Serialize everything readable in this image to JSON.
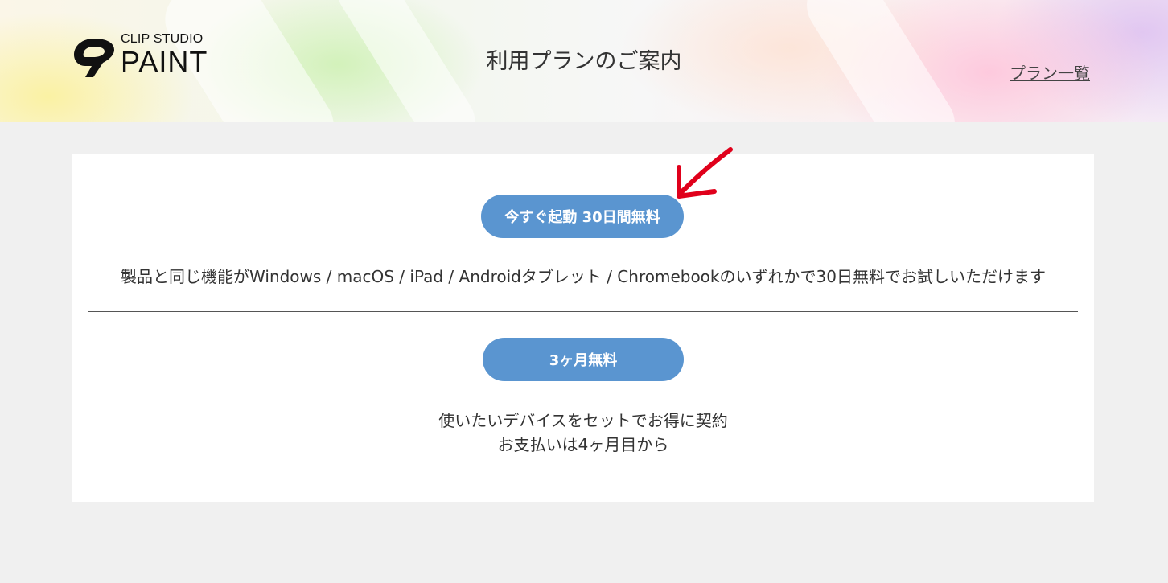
{
  "header": {
    "logo": {
      "small_text": "CLIP STUDIO",
      "big_text": "PAINT"
    },
    "title": "利用プランのご案内",
    "plan_list_link": "プラン一覧"
  },
  "main": {
    "trial": {
      "button_label": "今すぐ起動 30日間無料",
      "description": "製品と同じ機能がWindows / macOS / iPad / Androidタブレット / Chromebookのいずれかで30日無料でお試しいただけます"
    },
    "three_month": {
      "button_label": "3ヶ月無料",
      "description_line1": "使いたいデバイスをセットでお得に契約",
      "description_line2": "お支払いは4ヶ月目から"
    }
  },
  "colors": {
    "button": "#5a95d0",
    "annotation_arrow": "#e0001b",
    "page_background": "#f0f0f0"
  },
  "icons": {
    "logo_mark": "clip-studio-logo-icon",
    "annotation": "red-arrow-icon"
  }
}
